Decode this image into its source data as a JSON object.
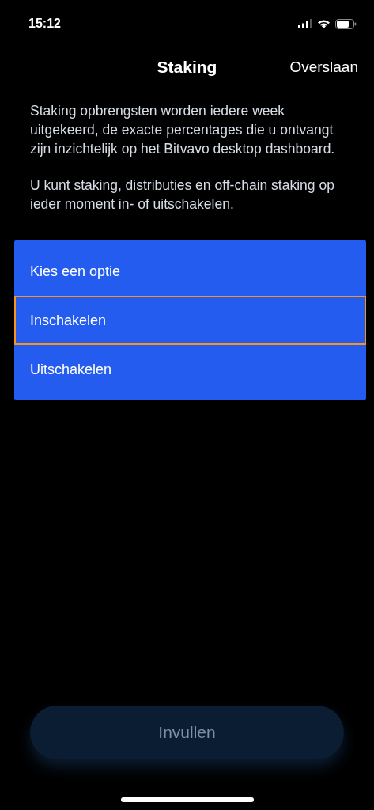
{
  "status_bar": {
    "time": "15:12"
  },
  "nav": {
    "title": "Staking",
    "skip": "Overslaan"
  },
  "paragraphs": [
    "Staking opbrengsten worden iedere week uitgekeerd, de exacte percentages die u ontvangt zijn inzichtelijk op het Bitvavo desktop dashboard.",
    "U kunt staking, distributies en off-chain staking op ieder moment in- of uitschakelen."
  ],
  "options": [
    {
      "label": "Kies een optie",
      "selected": false
    },
    {
      "label": "Inschakelen",
      "selected": true
    },
    {
      "label": "Uitschakelen",
      "selected": false
    }
  ],
  "submit": {
    "label": "Invullen",
    "disabled": true
  }
}
